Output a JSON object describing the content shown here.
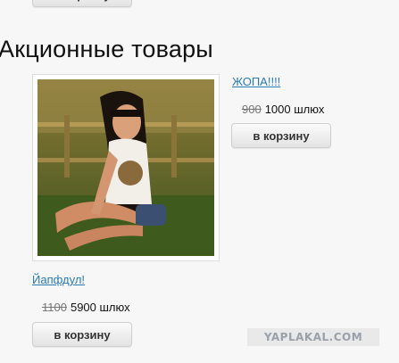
{
  "section": {
    "heading": "Акционные товары"
  },
  "top_product": {
    "cart_label": "в корзину"
  },
  "products": [
    {
      "name": "ЖОПА!!!!",
      "old_price": "900",
      "price": "1000 шлюх",
      "cart_label": "в корзину",
      "image": "product-photo"
    },
    {
      "name": "Йапфдул!",
      "old_price": "1100",
      "price": "5900 шлюх",
      "cart_label": "в корзину"
    }
  ],
  "watermark": "YAPLAKAL.COM",
  "colors": {
    "link": "#2a7ab0",
    "background": "#f7f7f7"
  }
}
